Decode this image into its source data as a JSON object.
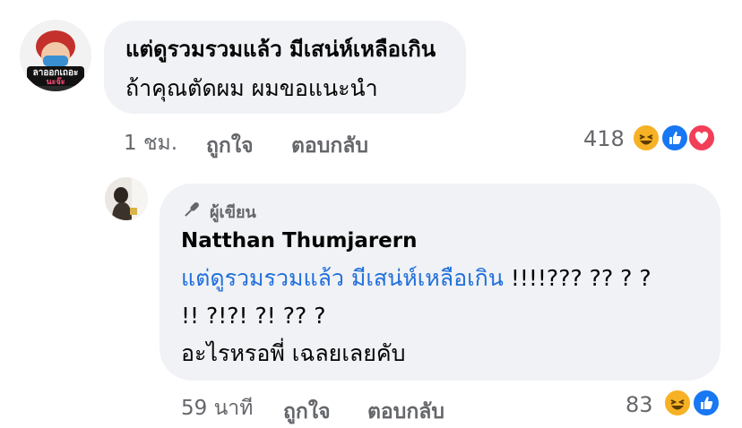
{
  "comment": {
    "avatar_caption_top": "ลาออกเถอะ",
    "avatar_caption_bottom": "นะจ๊ะ",
    "line1": "แต่ดูรวมรวมแล้ว มีเสน่ห์เหลือเกิน",
    "line2": "ถ้าคุณตัดผม ผมขอแนะนำ",
    "time": "1 ชม.",
    "like_label": "ถูกใจ",
    "reply_label": "ตอบกลับ",
    "reaction_count": "418",
    "reactions": [
      "haha-icon",
      "like-icon",
      "love-icon"
    ]
  },
  "reply": {
    "author_badge": "ผู้เขียน",
    "author_name": "Natthan Thumjarern",
    "quoted_text": "แต่ดูรวมรวมแล้ว มีเสน่ห์เหลือเกิน",
    "line1_rest": " !!!!??? ?? ? ?",
    "line2": "!! ?!?!  ?! ?? ?",
    "line3": "อะไรหรอพี่ เฉลยเลยคับ",
    "time": "59 นาที",
    "like_label": "ถูกใจ",
    "reply_label": "ตอบกลับ",
    "reaction_count": "83",
    "reactions": [
      "haha-icon",
      "like-icon"
    ]
  },
  "colors": {
    "bubble": "#f0f2f5",
    "link": "#216fdb",
    "meta": "#65676b",
    "like": "#1877f2",
    "love": "#f33e58",
    "haha": "#f7b125"
  }
}
